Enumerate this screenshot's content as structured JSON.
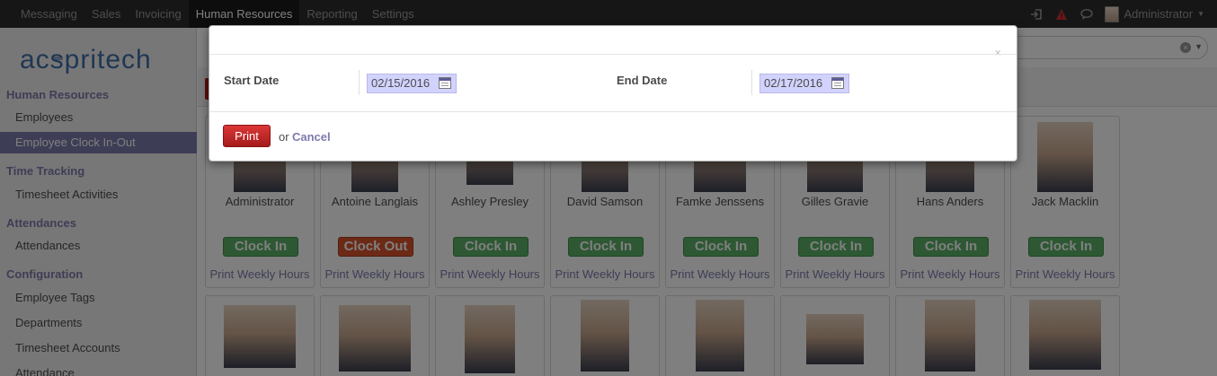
{
  "topbar": {
    "menu": [
      "Messaging",
      "Sales",
      "Invoicing",
      "Human Resources",
      "Reporting",
      "Settings"
    ],
    "active_index": 3,
    "user": "Administrator",
    "icons": [
      "login-icon",
      "alert-icon",
      "chat-icon"
    ]
  },
  "sidebar": {
    "logo_text": "acspritech",
    "sections": [
      {
        "title": "Human Resources",
        "items": [
          "Employees",
          "Employee Clock In-Out"
        ]
      },
      {
        "title": "Time Tracking",
        "items": [
          "Timesheet Activities"
        ]
      },
      {
        "title": "Attendances",
        "items": [
          "Attendances"
        ]
      },
      {
        "title": "Configuration",
        "items": [
          "Employee Tags",
          "Departments",
          "Timesheet Accounts",
          "Attendance"
        ]
      }
    ],
    "active_item": "Employee Clock In-Out"
  },
  "employees_row1": [
    {
      "name": "Administrator",
      "action": "Clock In",
      "status": "in"
    },
    {
      "name": "Antoine Langlais",
      "action": "Clock Out",
      "status": "out"
    },
    {
      "name": "Ashley Presley",
      "action": "Clock In",
      "status": "in"
    },
    {
      "name": "David Samson",
      "action": "Clock In",
      "status": "in"
    },
    {
      "name": "Famke Jenssens",
      "action": "Clock In",
      "status": "in"
    },
    {
      "name": "Gilles Gravie",
      "action": "Clock In",
      "status": "in"
    },
    {
      "name": "Hans Anders",
      "action": "Clock In",
      "status": "in"
    },
    {
      "name": "Jack Macklin",
      "action": "Clock In",
      "status": "in"
    }
  ],
  "print_link": "Print Weekly Hours",
  "dialog": {
    "close": "×",
    "start_label": "Start Date",
    "start_value": "02/15/2016",
    "end_label": "End Date",
    "end_value": "02/17/2016",
    "print_label": "Print",
    "or_text": "or",
    "cancel_label": "Cancel"
  },
  "colors": {
    "accent": "#7c7bad",
    "clock_in": "#5ab067",
    "clock_out": "#d9552c",
    "print": "#c62828",
    "topbar": "#2d2d2d"
  }
}
